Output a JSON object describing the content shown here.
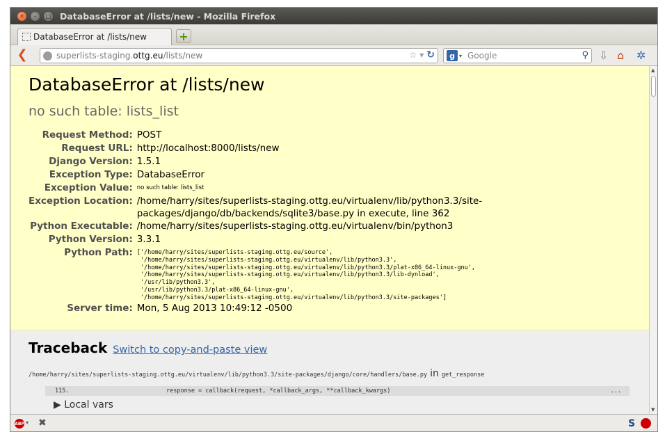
{
  "window": {
    "title": "DatabaseError at /lists/new - Mozilla Firefox"
  },
  "tab": {
    "label": "DatabaseError at /lists/new",
    "new_tab": "+"
  },
  "navbar": {
    "url_prefix": "superlists-staging.",
    "url_domain": "ottg.eu",
    "url_path": "/lists/new",
    "search_placeholder": "Google"
  },
  "page": {
    "title": "DatabaseError at /lists/new",
    "subtitle": "no such table: lists_list",
    "meta": {
      "request_method_label": "Request Method:",
      "request_method": "POST",
      "request_url_label": "Request URL:",
      "request_url": "http://localhost:8000/lists/new",
      "django_version_label": "Django Version:",
      "django_version": "1.5.1",
      "exception_type_label": "Exception Type:",
      "exception_type": "DatabaseError",
      "exception_value_label": "Exception Value:",
      "exception_value": "no such table: lists_list",
      "exception_location_label": "Exception Location:",
      "exception_location": "/home/harry/sites/superlists-staging.ottg.eu/virtualenv/lib/python3.3/site-packages/django/db/backends/sqlite3/base.py in execute, line 362",
      "python_executable_label": "Python Executable:",
      "python_executable": "/home/harry/sites/superlists-staging.ottg.eu/virtualenv/bin/python3",
      "python_version_label": "Python Version:",
      "python_version": "3.3.1",
      "python_path_label": "Python Path:",
      "python_path": "['/home/harry/sites/superlists-staging.ottg.eu/source',\n '/home/harry/sites/superlists-staging.ottg.eu/virtualenv/lib/python3.3',\n '/home/harry/sites/superlists-staging.ottg.eu/virtualenv/lib/python3.3/plat-x86_64-linux-gnu',\n '/home/harry/sites/superlists-staging.ottg.eu/virtualenv/lib/python3.3/lib-dynload',\n '/usr/lib/python3.3',\n '/usr/lib/python3.3/plat-x86_64-linux-gnu',\n '/home/harry/sites/superlists-staging.ottg.eu/virtualenv/lib/python3.3/site-packages']",
      "server_time_label": "Server time:",
      "server_time": "Mon, 5 Aug 2013 10:49:12 -0500"
    },
    "traceback": {
      "title": "Traceback",
      "switch_link": "Switch to copy-and-paste view",
      "frame_file": "/home/harry/sites/superlists-staging.ottg.eu/virtualenv/lib/python3.3/site-packages/django/core/handlers/base.py",
      "frame_in": "in",
      "frame_func": "get_response",
      "line_no": "115.",
      "line_code": "response = callback(request, *callback_args, **callback_kwargs)",
      "line_ellipsis": "...",
      "local_vars": "▶ Local vars"
    }
  },
  "icons": {
    "back": "back-arrow-icon",
    "home": "home-icon",
    "download": "download-icon",
    "adblock": "adblock-icon"
  },
  "colors": {
    "summary_bg": "#ffffc8",
    "traceback_bg": "#eeeeee",
    "link": "#3465a4",
    "titlebar": "#3c3b37"
  }
}
